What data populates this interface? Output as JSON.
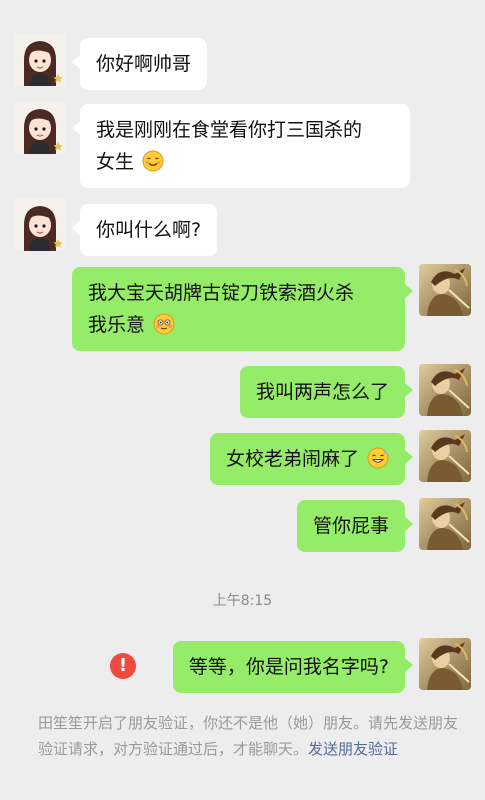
{
  "messages": [
    {
      "side": "left",
      "text": "你好啊帅哥",
      "emoji": ""
    },
    {
      "side": "left",
      "line1": "我是刚刚在食堂看你打三国杀的",
      "line2": "女生",
      "emoji": "blush-emoji"
    },
    {
      "side": "left",
      "text": "你叫什么啊?",
      "emoji": ""
    },
    {
      "side": "right",
      "line1": "我大宝天胡牌古锭刀铁索酒火杀",
      "line2": "我乐意",
      "emoji": "flushed-emoji"
    },
    {
      "side": "right",
      "text": "我叫两声怎么了",
      "emoji": ""
    },
    {
      "side": "right",
      "text": "女校老弟闹麻了",
      "emoji": "sweat-smile-emoji"
    },
    {
      "side": "right",
      "text": "管你屁事",
      "emoji": ""
    },
    {
      "side": "right",
      "text": "等等，你是问我名字吗?",
      "emoji": ""
    }
  ],
  "timestamp": "上午8:15",
  "error_icon": "!",
  "system_notice": {
    "text": "田笙笙开启了朋友验证，你还不是他（她）朋友。请先发送朋友验证请求，对方验证通过后，才能聊天。",
    "link": "发送朋友验证"
  },
  "colors": {
    "self_bubble": "#95ec69",
    "other_bubble": "#ffffff",
    "background": "#ededed",
    "link": "#576b95",
    "error": "#f04a3e"
  }
}
